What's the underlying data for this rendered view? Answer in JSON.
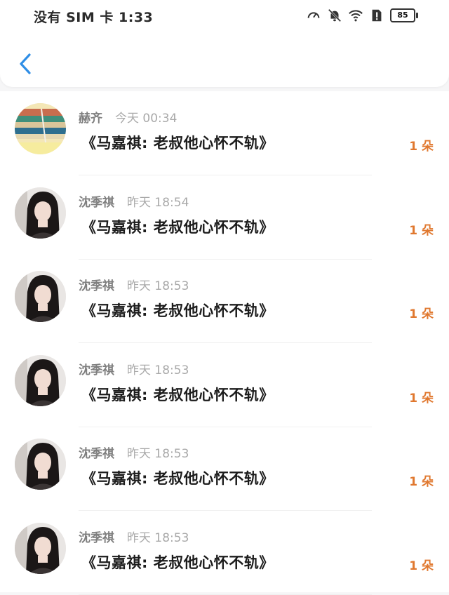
{
  "status_bar": {
    "carrier_text": "没有 SIM 卡 1:33",
    "battery_level": "85",
    "icons": [
      "speed-icon",
      "bell-muted-icon",
      "wifi-icon",
      "sim-alert-icon",
      "battery-icon"
    ]
  },
  "header": {
    "back_icon": "chevron-left-icon"
  },
  "colors": {
    "accent": "#2f8ee6",
    "count": "#e0782f",
    "background": "#f6f6f7"
  },
  "messages": [
    {
      "name": "赫齐",
      "time": "今天 00:34",
      "title": "《马嘉祺:  老叔他心怀不轨》",
      "count": "1 朵",
      "avatar": "books-avatar"
    },
    {
      "name": "沈季祺",
      "time": "昨天 18:54",
      "title": "《马嘉祺:  老叔他心怀不轨》",
      "count": "1 朵",
      "avatar": "girl-avatar"
    },
    {
      "name": "沈季祺",
      "time": "昨天 18:53",
      "title": "《马嘉祺:  老叔他心怀不轨》",
      "count": "1 朵",
      "avatar": "girl-avatar"
    },
    {
      "name": "沈季祺",
      "time": "昨天 18:53",
      "title": "《马嘉祺:  老叔他心怀不轨》",
      "count": "1 朵",
      "avatar": "girl-avatar"
    },
    {
      "name": "沈季祺",
      "time": "昨天 18:53",
      "title": "《马嘉祺:  老叔他心怀不轨》",
      "count": "1 朵",
      "avatar": "girl-avatar"
    },
    {
      "name": "沈季祺",
      "time": "昨天 18:53",
      "title": "《马嘉祺:  老叔他心怀不轨》",
      "count": "1 朵",
      "avatar": "girl-avatar"
    }
  ]
}
